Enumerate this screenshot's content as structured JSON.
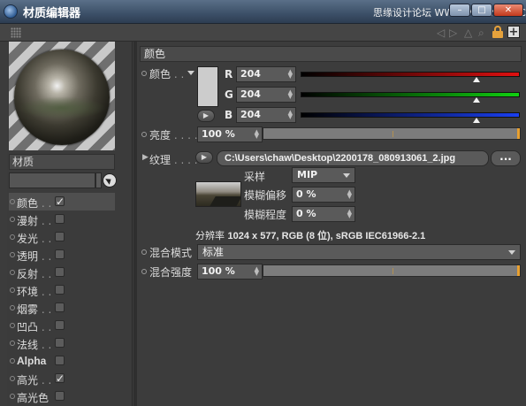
{
  "window": {
    "title": "材质编辑器",
    "watermark": "思缘设计论坛 WWW.MISSYUAN.COM",
    "minimize_label": "–",
    "maximize_label": "□",
    "close_label": "✕"
  },
  "toolbar": {
    "plus_label": "+"
  },
  "left": {
    "section_title": "材质",
    "name_value": "",
    "channels": [
      {
        "label": "颜色",
        "suffix": " . .",
        "checked": true,
        "check_mark": "✓"
      },
      {
        "label": "漫射",
        "suffix": " . .",
        "checked": false,
        "check_mark": ""
      },
      {
        "label": "发光",
        "suffix": " . .",
        "checked": false,
        "check_mark": ""
      },
      {
        "label": "透明",
        "suffix": " . .",
        "checked": false,
        "check_mark": ""
      },
      {
        "label": "反射",
        "suffix": " . .",
        "checked": false,
        "check_mark": ""
      },
      {
        "label": "环境",
        "suffix": " . .",
        "checked": false,
        "check_mark": ""
      },
      {
        "label": "烟雾",
        "suffix": " . .",
        "checked": false,
        "check_mark": ""
      },
      {
        "label": "凹凸",
        "suffix": " . .",
        "checked": false,
        "check_mark": ""
      },
      {
        "label": "法线",
        "suffix": " . .",
        "checked": false,
        "check_mark": ""
      },
      {
        "label": "Alpha",
        "suffix": "",
        "checked": false,
        "check_mark": ""
      },
      {
        "label": "高光",
        "suffix": " . .",
        "checked": true,
        "check_mark": "✓"
      },
      {
        "label": "高光色",
        "suffix": "",
        "checked": false,
        "check_mark": ""
      }
    ]
  },
  "color_section": {
    "header": "颜色",
    "color_label": "颜色",
    "color_dots": " . .",
    "swatch_color": "#cccccc",
    "channels": [
      {
        "name": "R",
        "value": "204",
        "level": 0.8,
        "color": "red"
      },
      {
        "name": "G",
        "value": "204",
        "level": 0.8,
        "color": "green"
      },
      {
        "name": "B",
        "value": "204",
        "level": 0.8,
        "color": "blue"
      }
    ],
    "brightness_label": "亮度",
    "brightness_dots": " . . . .",
    "brightness_value": "100 %",
    "brightness_level": 1.0,
    "texture_label": "纹理",
    "texture_dots": " . . . .",
    "texture_path": "C:\\Users\\chaw\\Desktop\\2200178_080913061_2.jpg",
    "more_label": "...",
    "sampling_label": "采样",
    "sampling_value": "MIP",
    "blur_offset_label": "模糊偏移",
    "blur_offset_value": "0 %",
    "blur_degree_label": "模糊程度",
    "blur_degree_value": "0 %",
    "resolution_label": "分辨率",
    "resolution_value": "1024 x 577, RGB (8 位), sRGB IEC61966-2.1",
    "mix_mode_label": "混合模式",
    "mix_mode_value": "标准",
    "mix_strength_label": "混合强度",
    "mix_strength_value": "100 %",
    "mix_strength_level": 1.0
  }
}
